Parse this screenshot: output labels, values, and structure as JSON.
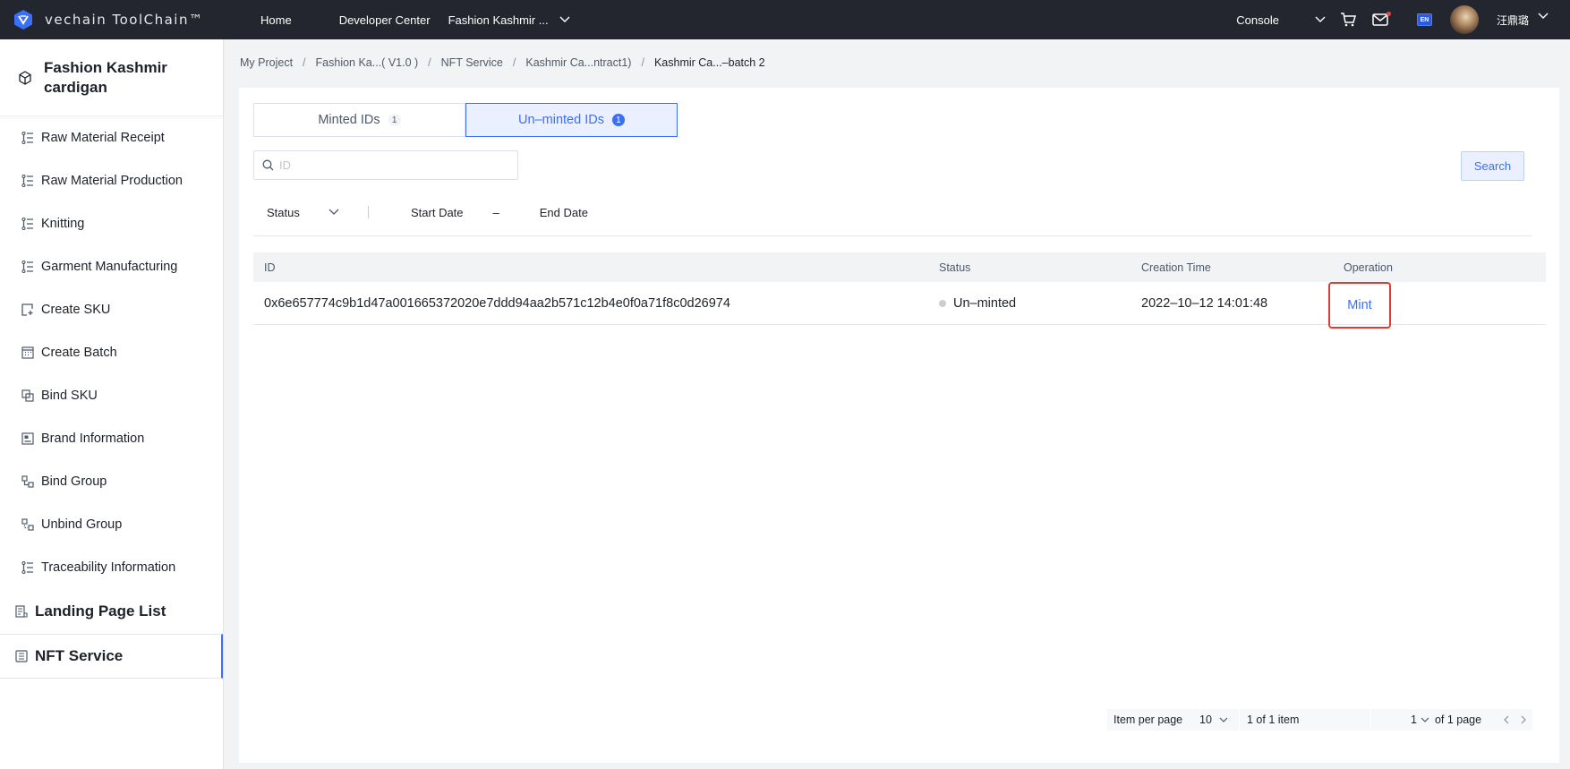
{
  "topbar": {
    "logo_text": "vechain ToolChain™",
    "nav": {
      "home": "Home",
      "developer_center": "Developer Center",
      "project": "Fashion Kashmir ..."
    },
    "console": "Console",
    "lang": "EN",
    "username": "汪鼎璐"
  },
  "sidebar": {
    "title": "Fashion Kashmir cardigan",
    "items": [
      {
        "label": "Raw Material Receipt",
        "icon": "steps-icon"
      },
      {
        "label": "Raw Material Production",
        "icon": "steps-icon"
      },
      {
        "label": "Knitting",
        "icon": "steps-icon"
      },
      {
        "label": "Garment Manufacturing",
        "icon": "steps-icon"
      },
      {
        "label": "Create SKU",
        "icon": "create-sku-icon"
      },
      {
        "label": "Create Batch",
        "icon": "calendar-grid-icon"
      },
      {
        "label": "Bind SKU",
        "icon": "bind-icon"
      },
      {
        "label": "Brand Information",
        "icon": "brand-card-icon"
      },
      {
        "label": "Bind Group",
        "icon": "group-icon"
      },
      {
        "label": "Unbind Group",
        "icon": "unbind-icon"
      },
      {
        "label": "Traceability Information",
        "icon": "steps-icon"
      }
    ],
    "landing_page_list": "Landing Page List",
    "nft_service": "NFT Service"
  },
  "breadcrumb": [
    "My Project",
    "Fashion Ka...( V1.0 )",
    "NFT Service",
    "Kashmir Ca...ntract1)",
    "Kashmir Ca...–batch 2"
  ],
  "tabs": {
    "minted": {
      "label": "Minted IDs",
      "count": "1"
    },
    "unminted": {
      "label": "Un–minted IDs",
      "count": "1"
    }
  },
  "search": {
    "placeholder": "ID",
    "value": "",
    "button": "Search"
  },
  "filters": {
    "status": "Status",
    "start_date": "Start Date",
    "dash": "–",
    "end_date": "End Date"
  },
  "table": {
    "columns": [
      "ID",
      "Status",
      "Creation Time",
      "Operation"
    ],
    "rows": [
      {
        "id": "0x6e657774c9b1d47a001665372020e7ddd94aa2b571c12b4e0f0a71f8c0d26974",
        "status": "Un–minted",
        "creation_time": "2022–10–12 14:01:48",
        "operation": "Mint"
      }
    ]
  },
  "pagination": {
    "label": "Item per page",
    "page_size": "10",
    "count": "1 of 1 item",
    "page": "1",
    "of_pages": "of 1 page"
  },
  "colors": {
    "topbar_bg": "#23262e",
    "accent": "#3a6ff8",
    "highlight_box": "#e53935"
  }
}
